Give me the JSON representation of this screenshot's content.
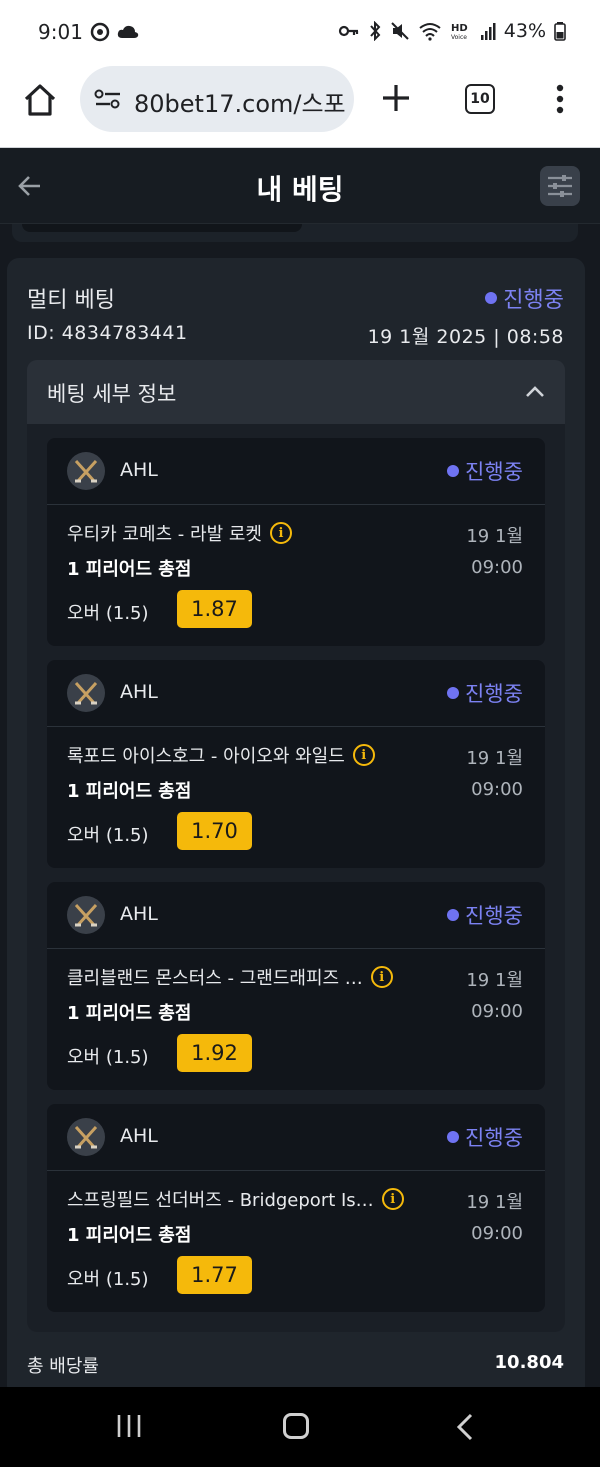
{
  "status_bar": {
    "time": "9:01",
    "battery": "43%",
    "icons": [
      "vpn-key-icon",
      "bluetooth-icon",
      "mute-icon",
      "wifi-icon",
      "hd-voice-icon",
      "signal-icon",
      "battery-icon"
    ]
  },
  "browser": {
    "url": "80bet17.com/스포",
    "tab_count": "10"
  },
  "header": {
    "title": "내 베팅"
  },
  "bet": {
    "type": "멀티 베팅",
    "status": "진행중",
    "id": "ID: 4834783441",
    "date": "19 1월 2025 | 08:58",
    "details_title": "베팅 세부 정보",
    "selections": [
      {
        "league": "AHL",
        "status": "진행중",
        "match": "우티카 코메츠 - 라발 로켓",
        "date": "19 1월",
        "time": "09:00",
        "market": "1 피리어드 총점",
        "pick": "오버 (1.5)",
        "odds": "1.87"
      },
      {
        "league": "AHL",
        "status": "진행중",
        "match": "록포드 아이스호그 - 아이오와 와일드",
        "date": "19 1월",
        "time": "09:00",
        "market": "1 피리어드 총점",
        "pick": "오버 (1.5)",
        "odds": "1.70"
      },
      {
        "league": "AHL",
        "status": "진행중",
        "match": "클리블랜드 몬스터스 - 그랜드래피즈 …",
        "date": "19 1월",
        "time": "09:00",
        "market": "1 피리어드 총점",
        "pick": "오버 (1.5)",
        "odds": "1.92"
      },
      {
        "league": "AHL",
        "status": "진행중",
        "match": "스프링필드 선더버즈 - Bridgeport Is…",
        "date": "19 1월",
        "time": "09:00",
        "market": "1 피리어드 총점",
        "pick": "오버 (1.5)",
        "odds": "1.77"
      }
    ],
    "total_odds_label": "총 배당률",
    "total_odds": "10.804"
  },
  "colors": {
    "accent_status": "#7c82f2",
    "odds_badge": "#f5b90b",
    "background": "#15191f"
  }
}
